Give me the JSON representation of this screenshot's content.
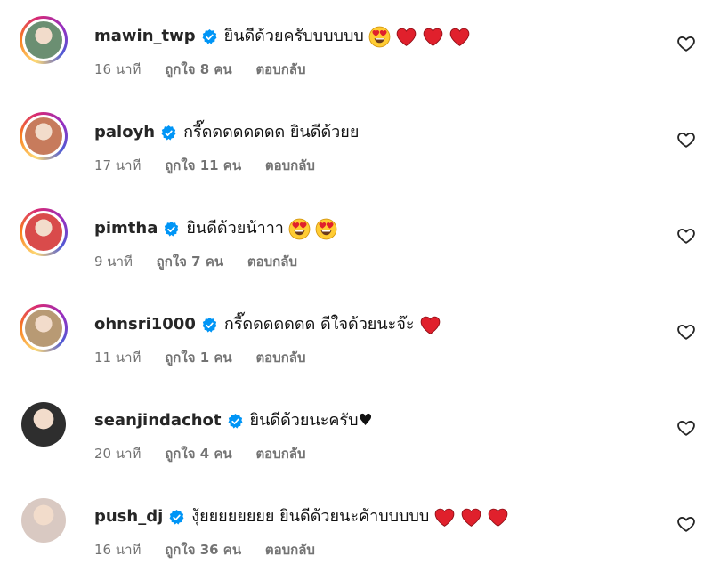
{
  "comments": [
    {
      "username": "mawin_twp",
      "text": "ยินดีด้วยครับบบบบบ",
      "emojis": [
        "heart-eyes",
        "red-heart",
        "red-heart",
        "red-heart"
      ],
      "time": "16 นาที",
      "likes": "ถูกใจ 8 คน",
      "reply": "ตอบกลับ",
      "story_ring": true,
      "avatar_color": "#6b8f72"
    },
    {
      "username": "paloyh",
      "text": "กรี๊ดดดดดดดด ยินดีด้วยย",
      "emojis": [],
      "time": "17 นาที",
      "likes": "ถูกใจ 11 คน",
      "reply": "ตอบกลับ",
      "story_ring": true,
      "avatar_color": "#c77b5c"
    },
    {
      "username": "pimtha",
      "text": "ยินดีด้วยน้าาา",
      "emojis": [
        "heart-eyes",
        "heart-eyes"
      ],
      "time": "9 นาที",
      "likes": "ถูกใจ 7 คน",
      "reply": "ตอบกลับ",
      "story_ring": true,
      "avatar_color": "#d94b4b"
    },
    {
      "username": "ohnsri1000",
      "text": "กรี๊ดดดดดดด ดีใจด้วยนะจ๊ะ",
      "emojis": [
        "red-heart"
      ],
      "time": "11 นาที",
      "likes": "ถูกใจ 1 คน",
      "reply": "ตอบกลับ",
      "story_ring": true,
      "avatar_color": "#b89a74"
    },
    {
      "username": "seanjindachot",
      "text": "ยินดีด้วยนะครับ♥",
      "emojis": [],
      "time": "20 นาที",
      "likes": "ถูกใจ 4 คน",
      "reply": "ตอบกลับ",
      "story_ring": false,
      "avatar_color": "#2e2e2e"
    },
    {
      "username": "push_dj",
      "text": "งุ้ยยยยยยยย ยินดีด้วยนะค้าบบบบบ",
      "emojis": [
        "red-heart",
        "red-heart",
        "red-heart"
      ],
      "time": "16 นาที",
      "likes": "ถูกใจ 36 คน",
      "reply": "ตอบกลับ",
      "story_ring": false,
      "avatar_color": "#d9c9c2"
    }
  ],
  "colors": {
    "verified": "#0095f6",
    "meta": "#737373",
    "heart_emoji": "#e0202c"
  }
}
